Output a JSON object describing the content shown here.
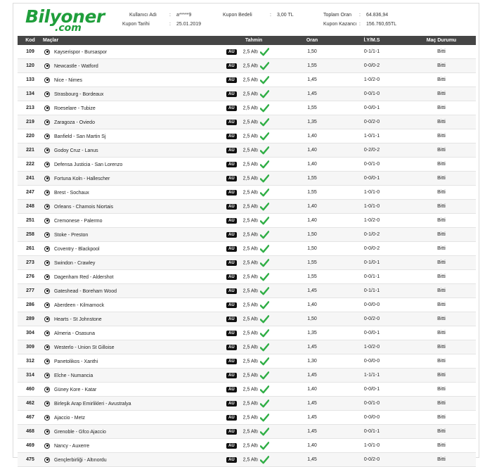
{
  "brand": {
    "logo_text": "Bilyoner",
    "logo_suffix": ".com",
    "accent_color": "#1f9e3b"
  },
  "coupon": {
    "user_label": "Kullanıcı Adı",
    "user_value": "a*****9",
    "date_label": "Kupon Tarihi",
    "date_value": "25.01.2019",
    "stake_label": "Kupon Bedeli",
    "stake_value": "3,00 TL",
    "total_odds_label": "Toplam Oran",
    "total_odds_value": "64.836,94",
    "winnings_label": "Kupon Kazancı",
    "winnings_value": "156.760,65TL"
  },
  "columns": [
    "Kod",
    "Maçlar",
    "Tahmin",
    "Oran",
    "İ.Y/M.S",
    "Maç Durumu"
  ],
  "icons": {
    "team": "soccer-ball-icon",
    "market": "au-badge-icon",
    "result": "check-icon"
  },
  "rows": [
    {
      "kod": "109",
      "mac": "Kayserispor - Bursaspor",
      "badge": "AÜ",
      "tahmin": "2,5 Altı",
      "oran": "1,50",
      "ims": "0-1/1-1",
      "durum": "Bitti"
    },
    {
      "kod": "120",
      "mac": "Newcastle - Watford",
      "badge": "AÜ",
      "tahmin": "2,5 Altı",
      "oran": "1,55",
      "ims": "0-0/0-2",
      "durum": "Bitti"
    },
    {
      "kod": "133",
      "mac": "Nice - Nimes",
      "badge": "AÜ",
      "tahmin": "2,5 Altı",
      "oran": "1,45",
      "ims": "1-0/2-0",
      "durum": "Bitti"
    },
    {
      "kod": "134",
      "mac": "Strasbourg - Bordeaux",
      "badge": "AÜ",
      "tahmin": "2,5 Altı",
      "oran": "1,45",
      "ims": "0-0/1-0",
      "durum": "Bitti"
    },
    {
      "kod": "213",
      "mac": "Roeselare - Tubize",
      "badge": "AÜ",
      "tahmin": "2,5 Altı",
      "oran": "1,55",
      "ims": "0-0/0-1",
      "durum": "Bitti"
    },
    {
      "kod": "219",
      "mac": "Zaragoza - Oviedo",
      "badge": "AÜ",
      "tahmin": "2,5 Altı",
      "oran": "1,35",
      "ims": "0-0/2-0",
      "durum": "Bitti"
    },
    {
      "kod": "220",
      "mac": "Banfield - San Martin Sj",
      "badge": "AÜ",
      "tahmin": "2,5 Altı",
      "oran": "1,40",
      "ims": "1-0/1-1",
      "durum": "Bitti"
    },
    {
      "kod": "221",
      "mac": "Godoy Cruz - Lanus",
      "badge": "AÜ",
      "tahmin": "2,5 Altı",
      "oran": "1,40",
      "ims": "0-2/0-2",
      "durum": "Bitti"
    },
    {
      "kod": "222",
      "mac": "Defensa Justicia - San Lorenzo",
      "badge": "AÜ",
      "tahmin": "2,5 Altı",
      "oran": "1,40",
      "ims": "0-0/1-0",
      "durum": "Bitti"
    },
    {
      "kod": "241",
      "mac": "Fortuna Koln - Hallescher",
      "badge": "AÜ",
      "tahmin": "2,5 Altı",
      "oran": "1,55",
      "ims": "0-0/0-1",
      "durum": "Bitti"
    },
    {
      "kod": "247",
      "mac": "Brest - Sochaux",
      "badge": "AÜ",
      "tahmin": "2,5 Altı",
      "oran": "1,55",
      "ims": "1-0/1-0",
      "durum": "Bitti"
    },
    {
      "kod": "248",
      "mac": "Orleans - Chamois Niortais",
      "badge": "AÜ",
      "tahmin": "2,5 Altı",
      "oran": "1,40",
      "ims": "1-0/1-0",
      "durum": "Bitti"
    },
    {
      "kod": "251",
      "mac": "Cremonese - Palermo",
      "badge": "AÜ",
      "tahmin": "2,5 Altı",
      "oran": "1,40",
      "ims": "1-0/2-0",
      "durum": "Bitti"
    },
    {
      "kod": "258",
      "mac": "Stoke - Preston",
      "badge": "AÜ",
      "tahmin": "2,5 Altı",
      "oran": "1,50",
      "ims": "0-1/0-2",
      "durum": "Bitti"
    },
    {
      "kod": "261",
      "mac": "Coventry - Blackpool",
      "badge": "AÜ",
      "tahmin": "2,5 Altı",
      "oran": "1,50",
      "ims": "0-0/0-2",
      "durum": "Bitti"
    },
    {
      "kod": "273",
      "mac": "Swindon - Crawley",
      "badge": "AÜ",
      "tahmin": "2,5 Altı",
      "oran": "1,55",
      "ims": "0-1/0-1",
      "durum": "Bitti"
    },
    {
      "kod": "276",
      "mac": "Dagenham Red - Aldershot",
      "badge": "AÜ",
      "tahmin": "2,5 Altı",
      "oran": "1,55",
      "ims": "0-0/1-1",
      "durum": "Bitti"
    },
    {
      "kod": "277",
      "mac": "Gateshead - Boreham Wood",
      "badge": "AÜ",
      "tahmin": "2,5 Altı",
      "oran": "1,45",
      "ims": "0-1/1-1",
      "durum": "Bitti"
    },
    {
      "kod": "286",
      "mac": "Aberdeen - Kilmarnock",
      "badge": "AÜ",
      "tahmin": "2,5 Altı",
      "oran": "1,40",
      "ims": "0-0/0-0",
      "durum": "Bitti"
    },
    {
      "kod": "289",
      "mac": "Hearts - St Johnstone",
      "badge": "AÜ",
      "tahmin": "2,5 Altı",
      "oran": "1,50",
      "ims": "0-0/2-0",
      "durum": "Bitti"
    },
    {
      "kod": "304",
      "mac": "Almeria - Osasuna",
      "badge": "AÜ",
      "tahmin": "2,5 Altı",
      "oran": "1,35",
      "ims": "0-0/0-1",
      "durum": "Bitti"
    },
    {
      "kod": "309",
      "mac": "Westerlo - Union St Gilloise",
      "badge": "AÜ",
      "tahmin": "2,5 Altı",
      "oran": "1,45",
      "ims": "1-0/2-0",
      "durum": "Bitti"
    },
    {
      "kod": "312",
      "mac": "Panetolikos - Xanthi",
      "badge": "AÜ",
      "tahmin": "2,5 Altı",
      "oran": "1,30",
      "ims": "0-0/0-0",
      "durum": "Bitti"
    },
    {
      "kod": "314",
      "mac": "Elche - Numancia",
      "badge": "AÜ",
      "tahmin": "2,5 Altı",
      "oran": "1,45",
      "ims": "1-1/1-1",
      "durum": "Bitti"
    },
    {
      "kod": "460",
      "mac": "Güney Kore - Katar",
      "badge": "AÜ",
      "tahmin": "2,5 Altı",
      "oran": "1,40",
      "ims": "0-0/0-1",
      "durum": "Bitti"
    },
    {
      "kod": "462",
      "mac": "Birleşik Arap Emirlikleri - Avustralya",
      "badge": "AÜ",
      "tahmin": "2,5 Altı",
      "oran": "1,45",
      "ims": "0-0/1-0",
      "durum": "Bitti"
    },
    {
      "kod": "467",
      "mac": "Ajaccio - Metz",
      "badge": "AÜ",
      "tahmin": "2,5 Altı",
      "oran": "1,45",
      "ims": "0-0/0-0",
      "durum": "Bitti"
    },
    {
      "kod": "468",
      "mac": "Grenoble - Gfco Ajaccio",
      "badge": "AÜ",
      "tahmin": "2,5 Altı",
      "oran": "1,45",
      "ims": "0-0/1-1",
      "durum": "Bitti"
    },
    {
      "kod": "469",
      "mac": "Nancy - Auxerre",
      "badge": "AÜ",
      "tahmin": "2,5 Altı",
      "oran": "1,40",
      "ims": "1-0/1-0",
      "durum": "Bitti"
    },
    {
      "kod": "475",
      "mac": "Gençlerbirliği - Altınordu",
      "badge": "AÜ",
      "tahmin": "2,5 Altı",
      "oran": "1,45",
      "ims": "0-0/2-0",
      "durum": "Bitti"
    }
  ]
}
